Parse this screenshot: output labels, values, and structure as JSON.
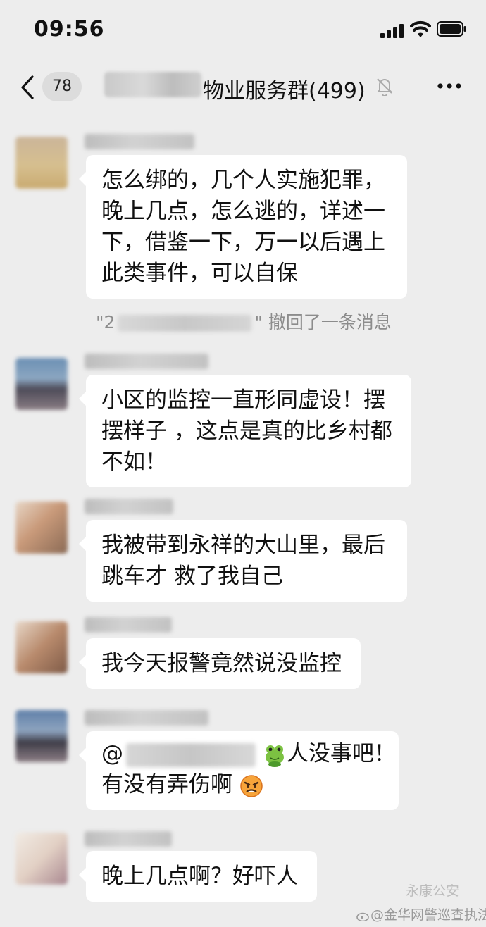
{
  "status_bar": {
    "time": "09:56"
  },
  "nav": {
    "back_count": "78",
    "group_title": "物业服务群(499)"
  },
  "messages": [
    {
      "text": "怎么绑的，几个人实施犯罪，晚上几点，怎么逃的，详述一下，借鉴一下，万一以后遇上此类事件，可以自保"
    },
    {
      "text": "小区的监控一直形同虚设！摆摆样子 ，这点是真的比乡村都不如！"
    },
    {
      "text": "我被带到永祥的大山里，最后跳车才 救了我自己"
    },
    {
      "text": "我今天报警竟然说没监控"
    },
    {
      "mention_prefix": "@",
      "line1_suffix": "人没事吧！",
      "line2": "有没有弄伤啊"
    },
    {
      "text": "晚上几点啊？好吓人"
    }
  ],
  "system_message": {
    "prefix": "\"2",
    "suffix": "\" 撤回了一条消息"
  },
  "sender_fragments": [
    "2",
    "2",
    "5",
    "5",
    "2",
    "5"
  ],
  "watermark": {
    "primary": "@金华网警巡查执法",
    "secondary": "永康公安"
  },
  "colors": {
    "background": "#ededed",
    "bubble": "#ffffff",
    "system_text": "#8c8c8c"
  }
}
